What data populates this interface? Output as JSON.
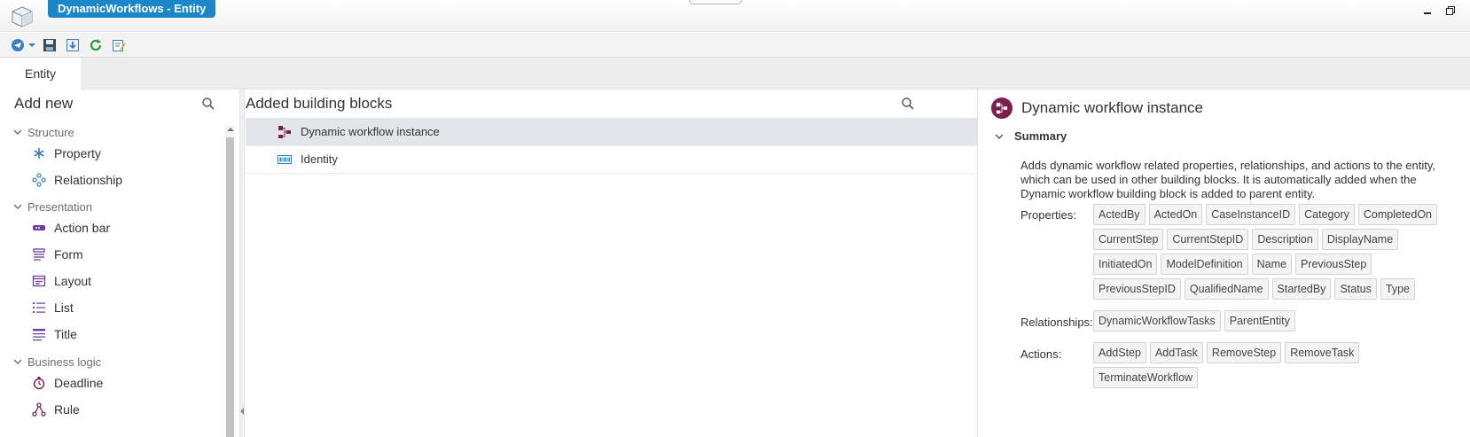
{
  "window": {
    "title": "DynamicWorkflows - Entity",
    "controls": [
      "minimize-icon",
      "restore-icon"
    ]
  },
  "toolbar": {
    "buttons": [
      "publish-icon",
      "save-icon",
      "export-icon",
      "refresh-icon",
      "edit-icon"
    ]
  },
  "tabs": [
    {
      "label": "Entity",
      "active": true
    }
  ],
  "left_pane": {
    "title": "Add new",
    "groups": [
      {
        "label": "Structure",
        "items": [
          {
            "label": "Property",
            "icon": "asterisk-icon"
          },
          {
            "label": "Relationship",
            "icon": "relationship-icon"
          }
        ]
      },
      {
        "label": "Presentation",
        "items": [
          {
            "label": "Action bar",
            "icon": "action-bar-icon"
          },
          {
            "label": "Form",
            "icon": "form-icon"
          },
          {
            "label": "Layout",
            "icon": "layout-icon"
          },
          {
            "label": "List",
            "icon": "list-icon"
          },
          {
            "label": "Title",
            "icon": "title-icon"
          }
        ]
      },
      {
        "label": "Business logic",
        "items": [
          {
            "label": "Deadline",
            "icon": "deadline-icon"
          },
          {
            "label": "Rule",
            "icon": "rule-icon"
          }
        ]
      }
    ]
  },
  "middle_pane": {
    "title": "Added building blocks",
    "blocks": [
      {
        "label": "Dynamic workflow instance",
        "icon": "workflow-icon",
        "selected": true
      },
      {
        "label": "Identity",
        "icon": "identity-icon",
        "selected": false
      }
    ]
  },
  "right_pane": {
    "title": "Dynamic workflow instance",
    "summary_label": "Summary",
    "description": "Adds dynamic workflow related properties, relationships, and actions to the entity, which can be used in other building blocks. It is automatically added when the Dynamic workflow building block is added to parent entity.",
    "properties_label": "Properties:",
    "properties": [
      "ActedBy",
      "ActedOn",
      "CaseInstanceID",
      "Category",
      "CompletedOn",
      "CurrentStep",
      "CurrentStepID",
      "Description",
      "DisplayName",
      "InitiatedOn",
      "ModelDefinition",
      "Name",
      "PreviousStep",
      "PreviousStepID",
      "QualifiedName",
      "StartedBy",
      "Status",
      "Type"
    ],
    "relationships_label": "Relationships:",
    "relationships": [
      "DynamicWorkflowTasks",
      "ParentEntity"
    ],
    "actions_label": "Actions:",
    "actions": [
      "AddStep",
      "AddTask",
      "RemoveStep",
      "RemoveTask",
      "TerminateWorkflow"
    ]
  },
  "colors": {
    "title_accent": "#1b87c9",
    "icon_blue": "#3a7fc2",
    "icon_purple": "#6b3fa0",
    "workflow_maroon": "#7c1f4d",
    "selected_row": "#e2e6ea"
  }
}
